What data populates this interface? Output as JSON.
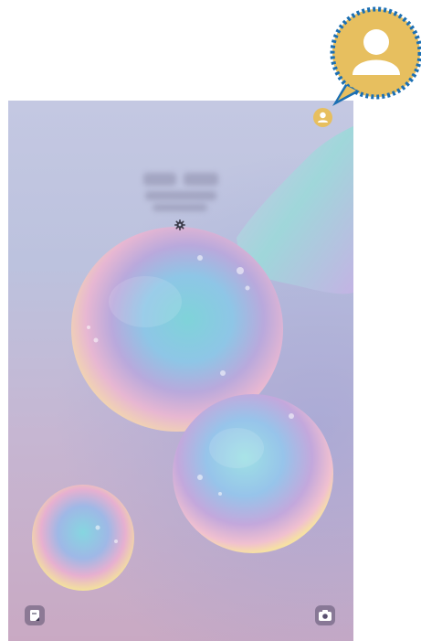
{
  "lock_screen": {
    "settings_icon": "gear-icon",
    "profile_icon": "user-profile-icon",
    "left_shortcut_icon": "notes-icon",
    "right_shortcut_icon": "camera-icon",
    "profile_color": "#e7bf5f"
  },
  "callout": {
    "icon": "user-profile-icon",
    "fill_color": "#e7bf5f",
    "border_color": "#1b6fb3"
  }
}
